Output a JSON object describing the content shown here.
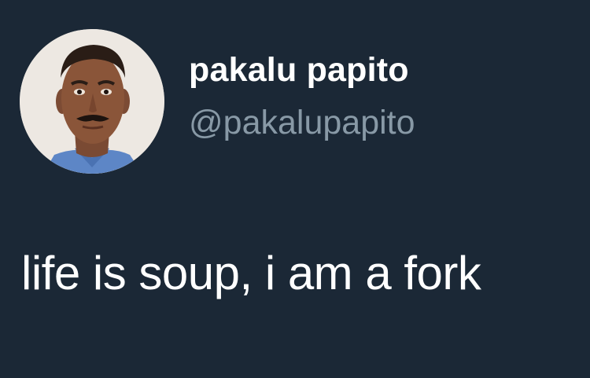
{
  "tweet": {
    "author": {
      "display_name": "pakalu papito",
      "handle": "@pakalupapito"
    },
    "text": "life is soup, i am a fork"
  },
  "colors": {
    "background": "#1b2836",
    "display_name": "#ffffff",
    "handle": "#8899a6",
    "text": "#ffffff"
  }
}
